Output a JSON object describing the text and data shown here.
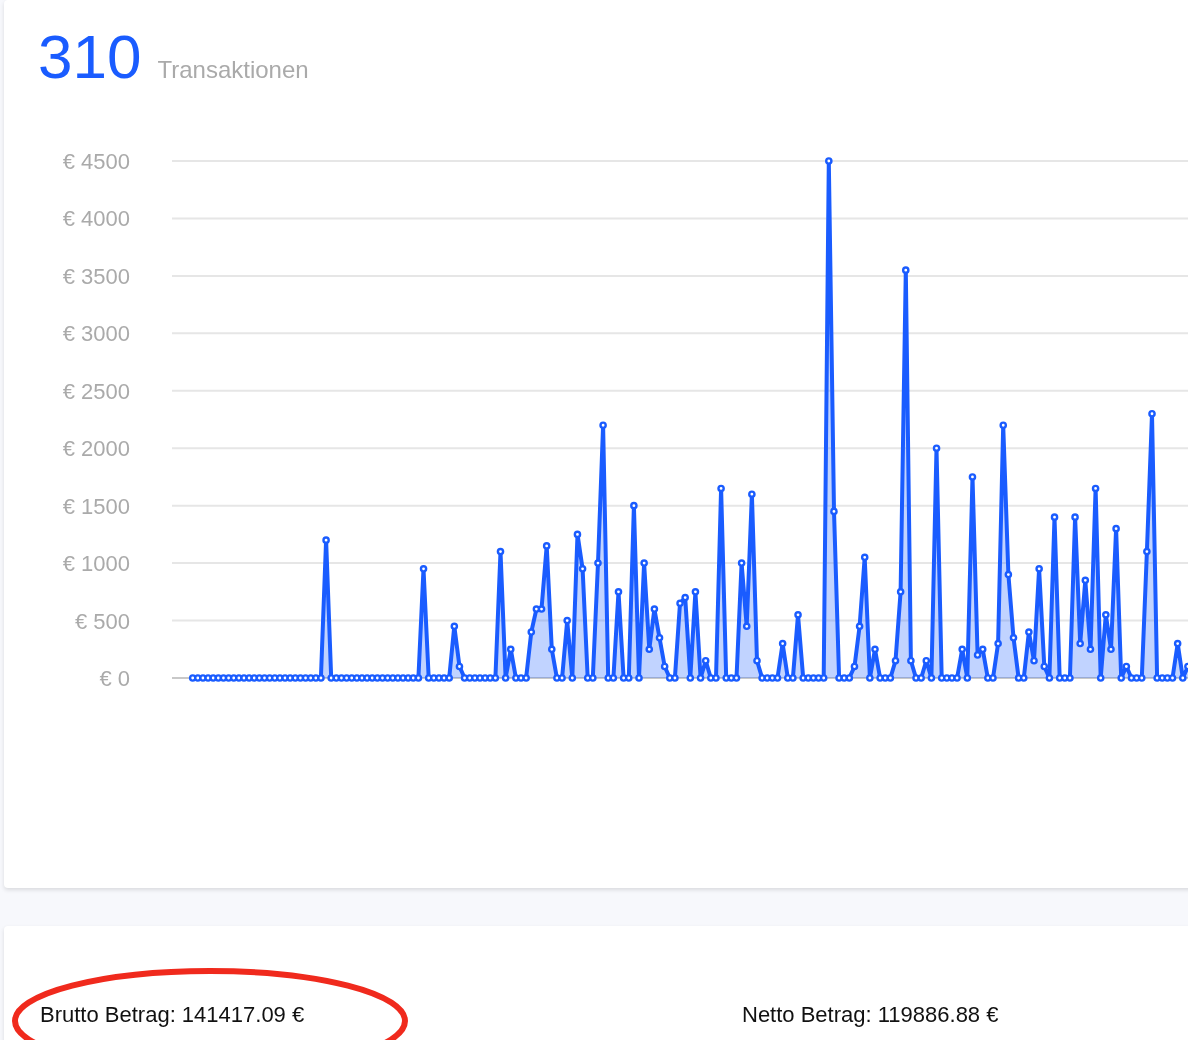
{
  "summary": {
    "count": "310",
    "label": "Transaktionen"
  },
  "chart_data": {
    "type": "area",
    "ylim": [
      0,
      4500
    ],
    "grid": true,
    "yticks": [
      {
        "value": 0,
        "label": "€ 0"
      },
      {
        "value": 500,
        "label": "€ 500"
      },
      {
        "value": 1000,
        "label": "€ 1000"
      },
      {
        "value": 1500,
        "label": "€ 1500"
      },
      {
        "value": 2000,
        "label": "€ 2000"
      },
      {
        "value": 2500,
        "label": "€ 2500"
      },
      {
        "value": 3000,
        "label": "€ 3000"
      },
      {
        "value": 3500,
        "label": "€ 3500"
      },
      {
        "value": 4000,
        "label": "€ 4000"
      },
      {
        "value": 4500,
        "label": "€ 4500"
      }
    ],
    "series": [
      {
        "color": "#1a5cff",
        "values": [
          0,
          0,
          0,
          0,
          0,
          0,
          0,
          0,
          0,
          0,
          0,
          0,
          0,
          0,
          0,
          0,
          0,
          0,
          0,
          0,
          0,
          0,
          0,
          0,
          0,
          0,
          1200,
          0,
          0,
          0,
          0,
          0,
          0,
          0,
          0,
          0,
          0,
          0,
          0,
          0,
          0,
          0,
          0,
          0,
          0,
          950,
          0,
          0,
          0,
          0,
          0,
          450,
          100,
          0,
          0,
          0,
          0,
          0,
          0,
          0,
          1100,
          0,
          250,
          0,
          0,
          0,
          400,
          600,
          600,
          1150,
          250,
          0,
          0,
          500,
          0,
          1250,
          950,
          0,
          0,
          1000,
          2200,
          0,
          0,
          750,
          0,
          0,
          1500,
          0,
          1000,
          250,
          600,
          350,
          100,
          0,
          0,
          650,
          700,
          0,
          750,
          0,
          150,
          0,
          0,
          1650,
          0,
          0,
          0,
          1000,
          450,
          1600,
          150,
          0,
          0,
          0,
          0,
          300,
          0,
          0,
          550,
          0,
          0,
          0,
          0,
          0,
          4500,
          1450,
          0,
          0,
          0,
          100,
          450,
          1050,
          0,
          250,
          0,
          0,
          0,
          150,
          750,
          3550,
          150,
          0,
          0,
          150,
          0,
          2000,
          0,
          0,
          0,
          0,
          250,
          0,
          1750,
          200,
          250,
          0,
          0,
          300,
          2200,
          900,
          350,
          0,
          0,
          400,
          150,
          950,
          100,
          0,
          1400,
          0,
          0,
          0,
          1400,
          300,
          850,
          250,
          1650,
          0,
          550,
          250,
          1300,
          0,
          100,
          0,
          0,
          0,
          1100,
          2300,
          0,
          0,
          0,
          0,
          300,
          0,
          100
        ]
      }
    ]
  },
  "totals": [
    {
      "text": "Brutto Betrag: 141417.09 €",
      "highlighted": true
    },
    {
      "text": "Netto Betrag: 119886.88 €",
      "highlighted": false
    }
  ]
}
